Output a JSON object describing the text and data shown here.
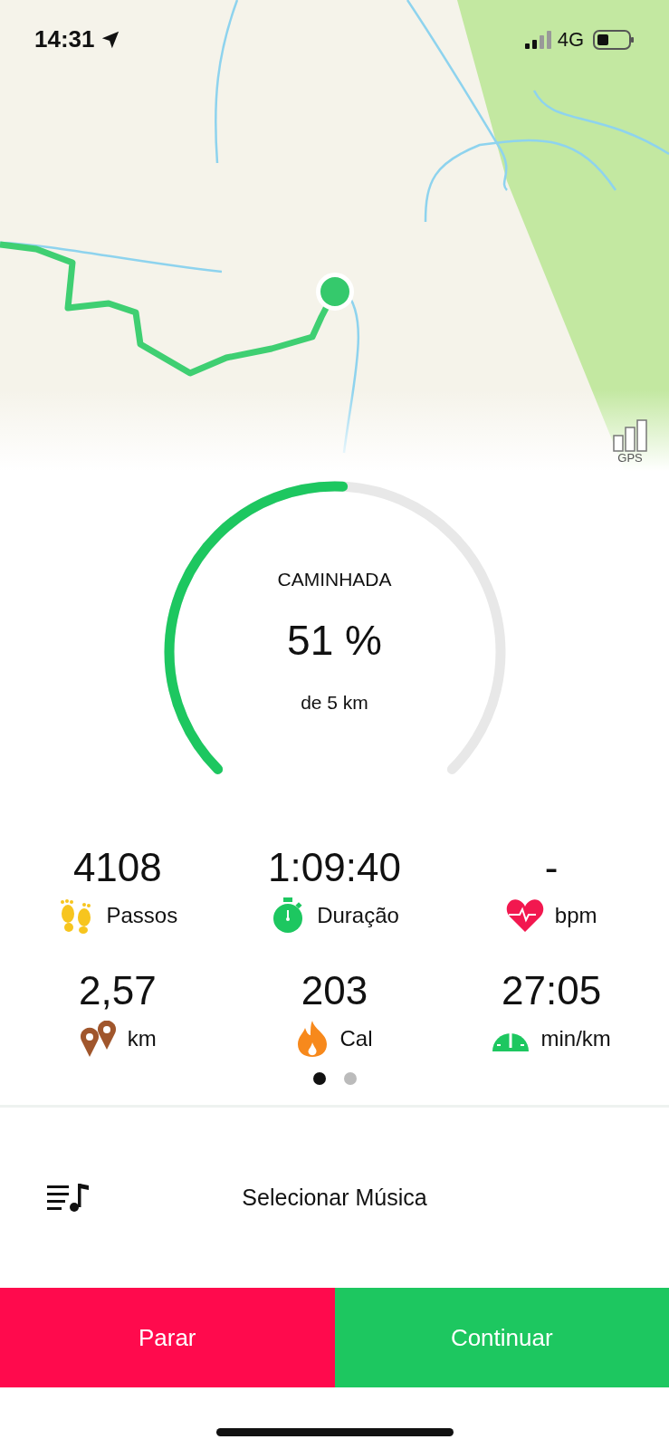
{
  "status_bar": {
    "time": "14:31",
    "network": "4G"
  },
  "map": {
    "gps_label": "GPS"
  },
  "goal": {
    "activity": "CAMINHADA",
    "percent": "51 %",
    "target": "de 5 km"
  },
  "stats": [
    {
      "value": "4108",
      "label": "Passos",
      "kind": "steps"
    },
    {
      "value": "1:09:40",
      "label": "Duração",
      "kind": "stopwatch"
    },
    {
      "value": "-",
      "label": "bpm",
      "kind": "heart"
    },
    {
      "value": "2,57",
      "label": "km",
      "kind": "pins"
    },
    {
      "value": "203",
      "label": "Cal",
      "kind": "flame"
    },
    {
      "value": "27:05",
      "label": "min/km",
      "kind": "gauge"
    }
  ],
  "pager": [
    {
      "selected": true
    },
    {
      "selected": false
    }
  ],
  "music": {
    "label": "Selecionar Música"
  },
  "buttons": [
    {
      "label": "Parar",
      "kind": "stop"
    },
    {
      "label": "Continuar",
      "kind": "continue"
    }
  ]
}
